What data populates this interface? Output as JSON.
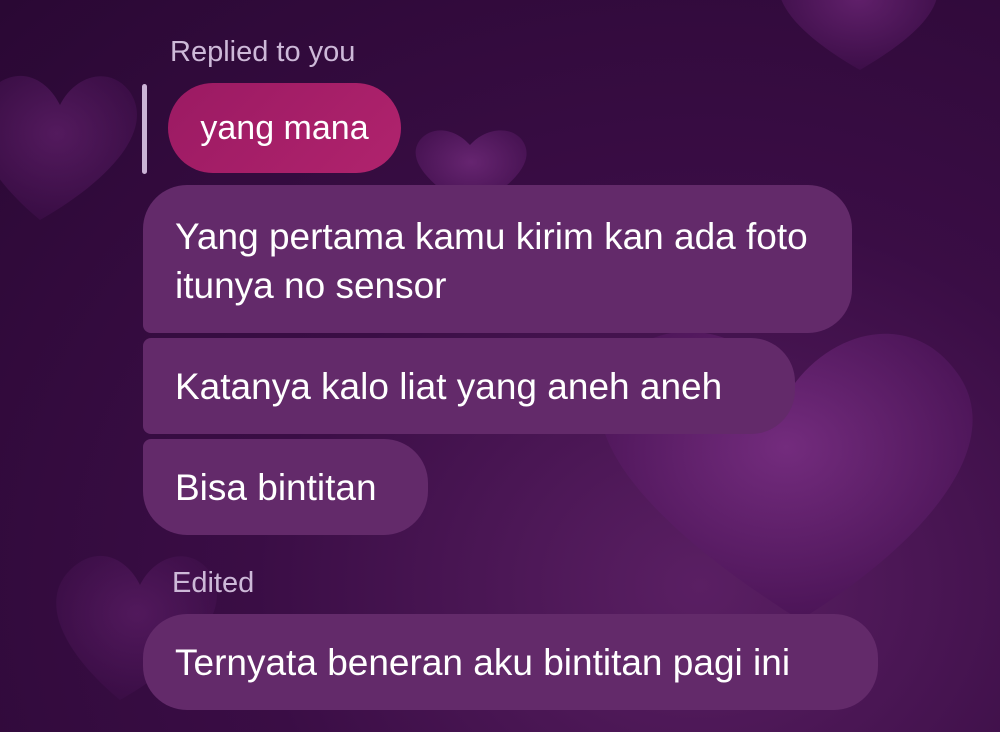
{
  "reply": {
    "label": "Replied to you",
    "quoted_text": "yang mana"
  },
  "messages": [
    {
      "text": "Yang pertama kamu kirim kan ada foto itunya no sensor"
    },
    {
      "text": "Katanya kalo liat yang aneh aneh"
    },
    {
      "text": "Bisa bintitan"
    }
  ],
  "edited": {
    "label": "Edited",
    "text": "Ternyata beneran aku bintitan pagi ini"
  },
  "colors": {
    "background": "#3a0d45",
    "bubble": "#632a6a",
    "reply_bubble": "#a51f68",
    "label": "#cdb9d8"
  }
}
